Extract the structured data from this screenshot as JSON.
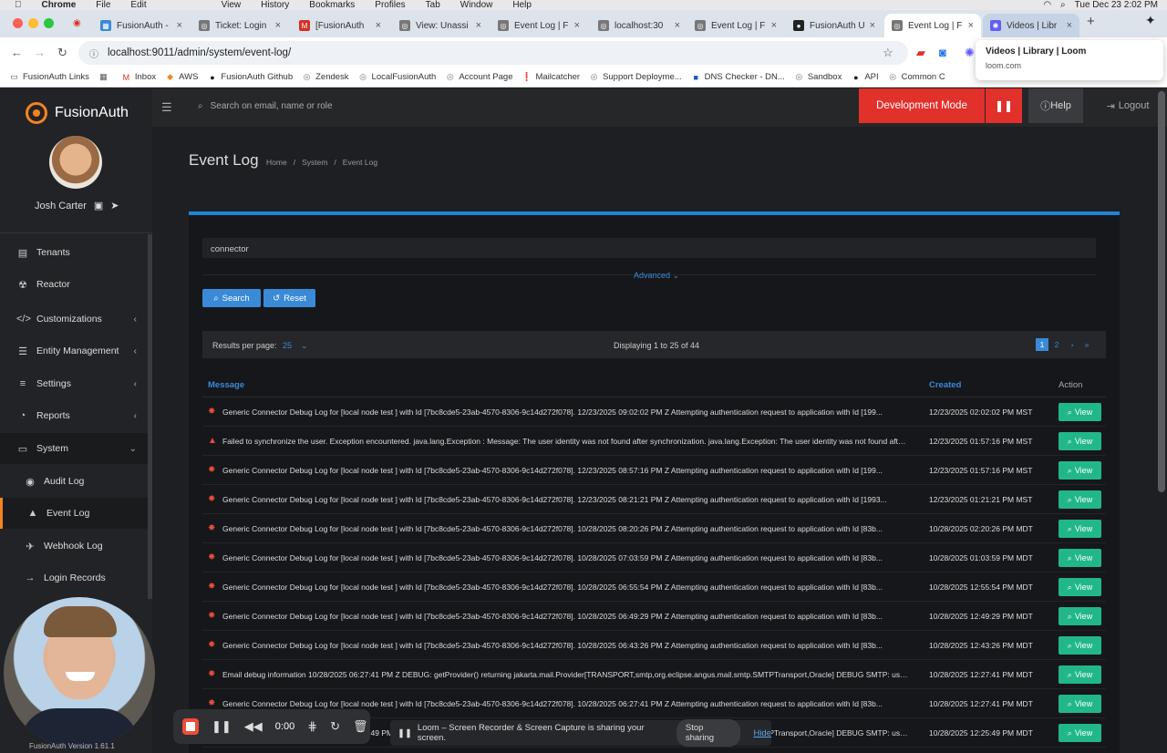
{
  "menubar": {
    "items": [
      "Chrome",
      "File",
      "Edit",
      "View",
      "History",
      "Bookmarks",
      "Profiles",
      "Tab",
      "Window",
      "Help"
    ],
    "clock": "Tue Dec 23  2:02 PM"
  },
  "tabs": [
    {
      "title": "FusionAuth -",
      "color": "#3a8ad8",
      "glyph": "▦"
    },
    {
      "title": "Ticket: Login",
      "color": "#777",
      "glyph": "◎"
    },
    {
      "title": "[FusionAuth",
      "color": "#d93025",
      "glyph": "M"
    },
    {
      "title": "View: Unassi",
      "color": "#777",
      "glyph": "◎"
    },
    {
      "title": "Event Log | F",
      "color": "#777",
      "glyph": "◎"
    },
    {
      "title": "localhost:30",
      "color": "#777",
      "glyph": "◎"
    },
    {
      "title": "Event Log | F",
      "color": "#777",
      "glyph": "◎"
    },
    {
      "title": "FusionAuth U",
      "color": "#222",
      "glyph": "●"
    },
    {
      "title": "Event Log | F",
      "color": "#777",
      "glyph": "◎"
    },
    {
      "title": "Videos | Libr",
      "color": "#625df5",
      "glyph": "✺"
    }
  ],
  "address": {
    "url": "localhost:9011/admin/system/event-log/"
  },
  "bookmarks": [
    {
      "label": "FusionAuth Links",
      "glyph": "▭",
      "color": "#555"
    },
    {
      "label": "",
      "glyph": "▦",
      "color": "#555"
    },
    {
      "label": "Inbox",
      "glyph": "M",
      "color": "#d93025"
    },
    {
      "label": "AWS",
      "glyph": "◆",
      "color": "#f58320"
    },
    {
      "label": "FusionAuth Github",
      "glyph": "●",
      "color": "#222"
    },
    {
      "label": "Zendesk",
      "glyph": "◎",
      "color": "#777"
    },
    {
      "label": "LocalFusionAuth",
      "glyph": "◎",
      "color": "#777"
    },
    {
      "label": "Account Page",
      "glyph": "◎",
      "color": "#777"
    },
    {
      "label": "Mailcatcher",
      "glyph": "❗",
      "color": "#555"
    },
    {
      "label": "Support Deployme...",
      "glyph": "◎",
      "color": "#777"
    },
    {
      "label": "DNS Checker - DN...",
      "glyph": "■",
      "color": "#1a56c4"
    },
    {
      "label": "Sandbox",
      "glyph": "◎",
      "color": "#777"
    },
    {
      "label": "API",
      "glyph": "●",
      "color": "#222"
    },
    {
      "label": "Common C",
      "glyph": "◎",
      "color": "#777"
    }
  ],
  "tooltip": {
    "title": "Videos | Library | Loom",
    "domain": "loom.com"
  },
  "app": {
    "brand": "FusionAuth",
    "user": "Josh Carter",
    "version": "FusionAuth Version 1.61.1",
    "search_placeholder": "Search on email, name or role",
    "dev_mode": "Development Mode",
    "help": "Help",
    "logout": "Logout",
    "nav": [
      {
        "label": "Tenants",
        "icon": "▤",
        "chevron": ""
      },
      {
        "label": "Reactor",
        "icon": "☢",
        "chevron": ""
      },
      {
        "label": "Customizations",
        "icon": "</>",
        "chevron": "‹"
      },
      {
        "label": "Entity Management",
        "icon": "☰",
        "chevron": "‹"
      },
      {
        "label": "Settings",
        "icon": "≡",
        "chevron": "‹"
      },
      {
        "label": "Reports",
        "icon": "◔",
        "chevron": "‹"
      },
      {
        "label": "System",
        "icon": "▭",
        "chevron": "⌄"
      },
      {
        "label": "Audit Log",
        "icon": "◉",
        "chevron": ""
      },
      {
        "label": "Event Log",
        "icon": "▲",
        "chevron": ""
      },
      {
        "label": "Webhook Log",
        "icon": "✈",
        "chevron": ""
      },
      {
        "label": "Login Records",
        "icon": "→",
        "chevron": ""
      }
    ]
  },
  "page": {
    "title": "Event Log",
    "breadcrumbs": [
      "Home",
      "/",
      "System",
      "/",
      "Event Log"
    ],
    "filter_value": "connector",
    "advanced": "Advanced ⌄",
    "search_btn": "Search",
    "reset_btn": "Reset",
    "results_per_page_label": "Results per page:",
    "results_per_page": "25",
    "displaying": "Displaying 1 to 25 of 44",
    "pages": [
      "1",
      "2",
      "›",
      "»"
    ],
    "col_message": "Message",
    "col_created": "Created",
    "col_action": "Action",
    "view_label": "View",
    "rows": [
      {
        "icon": "✸",
        "msg": "Generic Connector Debug Log for [local node test ] with Id [7bc8cde5-23ab-4570-8306-9c14d272f078]. 12/23/2025 09:02:02 PM Z Attempting authentication request to application with Id [199...",
        "created": "12/23/2025 02:02:02 PM MST"
      },
      {
        "icon": "▲",
        "msg": "Failed to synchronize the user. Exception encountered. java.lang.Exception : Message: The user identity was not found after synchronization. java.lang.Exception: The user identity was not found after...",
        "created": "12/23/2025 01:57:16 PM MST"
      },
      {
        "icon": "✸",
        "msg": "Generic Connector Debug Log for [local node test ] with Id [7bc8cde5-23ab-4570-8306-9c14d272f078]. 12/23/2025 08:57:16 PM Z Attempting authentication request to application with Id [199...",
        "created": "12/23/2025 01:57:16 PM MST"
      },
      {
        "icon": "✸",
        "msg": "Generic Connector Debug Log for [local node test ] with Id [7bc8cde5-23ab-4570-8306-9c14d272f078]. 12/23/2025 08:21:21 PM Z Attempting authentication request to application with Id [1993...",
        "created": "12/23/2025 01:21:21 PM MST"
      },
      {
        "icon": "✸",
        "msg": "Generic Connector Debug Log for [local node test ] with Id [7bc8cde5-23ab-4570-8306-9c14d272f078]. 10/28/2025 08:20:26 PM Z Attempting authentication request to application with Id [83b...",
        "created": "10/28/2025 02:20:26 PM MDT"
      },
      {
        "icon": "✸",
        "msg": "Generic Connector Debug Log for [local node test ] with Id [7bc8cde5-23ab-4570-8306-9c14d272f078]. 10/28/2025 07:03:59 PM Z Attempting authentication request to application with Id [83b...",
        "created": "10/28/2025 01:03:59 PM MDT"
      },
      {
        "icon": "✸",
        "msg": "Generic Connector Debug Log for [local node test ] with Id [7bc8cde5-23ab-4570-8306-9c14d272f078]. 10/28/2025 06:55:54 PM Z Attempting authentication request to application with Id [83b...",
        "created": "10/28/2025 12:55:54 PM MDT"
      },
      {
        "icon": "✸",
        "msg": "Generic Connector Debug Log for [local node test ] with Id [7bc8cde5-23ab-4570-8306-9c14d272f078]. 10/28/2025 06:49:29 PM Z Attempting authentication request to application with Id [83b...",
        "created": "10/28/2025 12:49:29 PM MDT"
      },
      {
        "icon": "✸",
        "msg": "Generic Connector Debug Log for [local node test ] with Id [7bc8cde5-23ab-4570-8306-9c14d272f078]. 10/28/2025 06:43:26 PM Z Attempting authentication request to application with Id [83b...",
        "created": "10/28/2025 12:43:26 PM MDT"
      },
      {
        "icon": "✸",
        "msg": "Email debug information 10/28/2025 06:27:41 PM Z DEBUG: getProvider() returning jakarta.mail.Provider[TRANSPORT,smtp,org.eclipse.angus.mail.smtp.SMTPTransport,Oracle] DEBUG SMTP: use...",
        "created": "10/28/2025 12:27:41 PM MDT"
      },
      {
        "icon": "✸",
        "msg": "Generic Connector Debug Log for [local node test ] with Id [7bc8cde5-23ab-4570-8306-9c14d272f078]. 10/28/2025 06:27:41 PM Z Attempting authentication request to application with Id [83b...",
        "created": "10/28/2025 12:27:41 PM MDT"
      },
      {
        "icon": "✸",
        "msg": "Email debug information 10/28/2025 06:25:49 PM Z DEBUG: getProvider() returning jakarta.mail.Provider[TRANSPORT,smtp,org.eclipse.angus.mail.smtp.SMTPTransport,Oracle] DEBUG SMTP: use...",
        "created": "10/28/2025 12:25:49 PM MDT"
      }
    ]
  },
  "loom": {
    "time": "0:00",
    "sharing": "Loom – Screen Recorder & Screen Capture is sharing your screen.",
    "stop": "Stop sharing",
    "hide": "Hide"
  }
}
